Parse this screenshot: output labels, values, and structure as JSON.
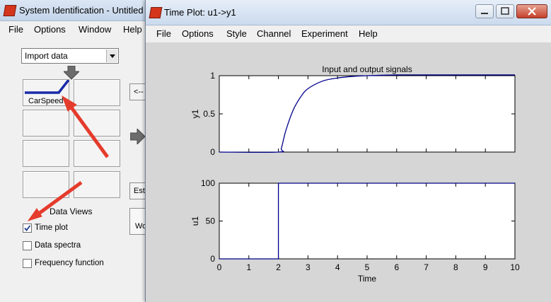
{
  "back_window": {
    "title": "System Identification - Untitled",
    "menu": [
      "File",
      "Options",
      "Window",
      "Help"
    ],
    "import_select": "Import data",
    "data_item": "CarSpeed",
    "data_views_label": "Data Views",
    "checkboxes": [
      {
        "label": "Time plot",
        "checked": true
      },
      {
        "label": "Data spectra",
        "checked": false
      },
      {
        "label": "Frequency function",
        "checked": false
      }
    ],
    "side_buttons": [
      "<--",
      "Est",
      "Wo"
    ]
  },
  "front_window": {
    "title": "Time Plot: u1->y1",
    "menu": [
      "File",
      "Options",
      "Style",
      "Channel",
      "Experiment",
      "Help"
    ]
  },
  "colors": {
    "signal": "#00008b",
    "annotation_arrow": "#e53b2c"
  },
  "chart_data": [
    {
      "type": "line",
      "title": "Input and output signals",
      "ylabel": "y1",
      "xlabel": "",
      "xlim": [
        0,
        10
      ],
      "ylim": [
        0,
        1
      ],
      "yticks": [
        0,
        0.5,
        1
      ],
      "ytick_labels": [
        "0",
        "0.5",
        "1"
      ],
      "series": [
        {
          "x": [
            0,
            2,
            2.1,
            2.25,
            2.5,
            2.75,
            3,
            3.5,
            4,
            4.5,
            5,
            6,
            7,
            8,
            9,
            10
          ],
          "values": [
            0,
            0,
            0.05,
            0.28,
            0.55,
            0.72,
            0.83,
            0.93,
            0.97,
            0.99,
            1.0,
            1.01,
            1.01,
            1.01,
            1.01,
            1.01
          ]
        }
      ]
    },
    {
      "type": "line",
      "title": "",
      "ylabel": "u1",
      "xlabel": "Time",
      "xlim": [
        0,
        10
      ],
      "ylim": [
        0,
        100
      ],
      "yticks": [
        0,
        50,
        100
      ],
      "ytick_labels": [
        "0",
        "50",
        "100"
      ],
      "xticks": [
        0,
        1,
        2,
        3,
        4,
        5,
        6,
        7,
        8,
        9,
        10
      ],
      "xtick_labels": [
        "0",
        "1",
        "2",
        "3",
        "4",
        "5",
        "6",
        "7",
        "8",
        "9",
        "10"
      ],
      "series": [
        {
          "x": [
            0,
            2,
            2,
            10
          ],
          "values": [
            0,
            0,
            100,
            100
          ]
        }
      ]
    }
  ]
}
